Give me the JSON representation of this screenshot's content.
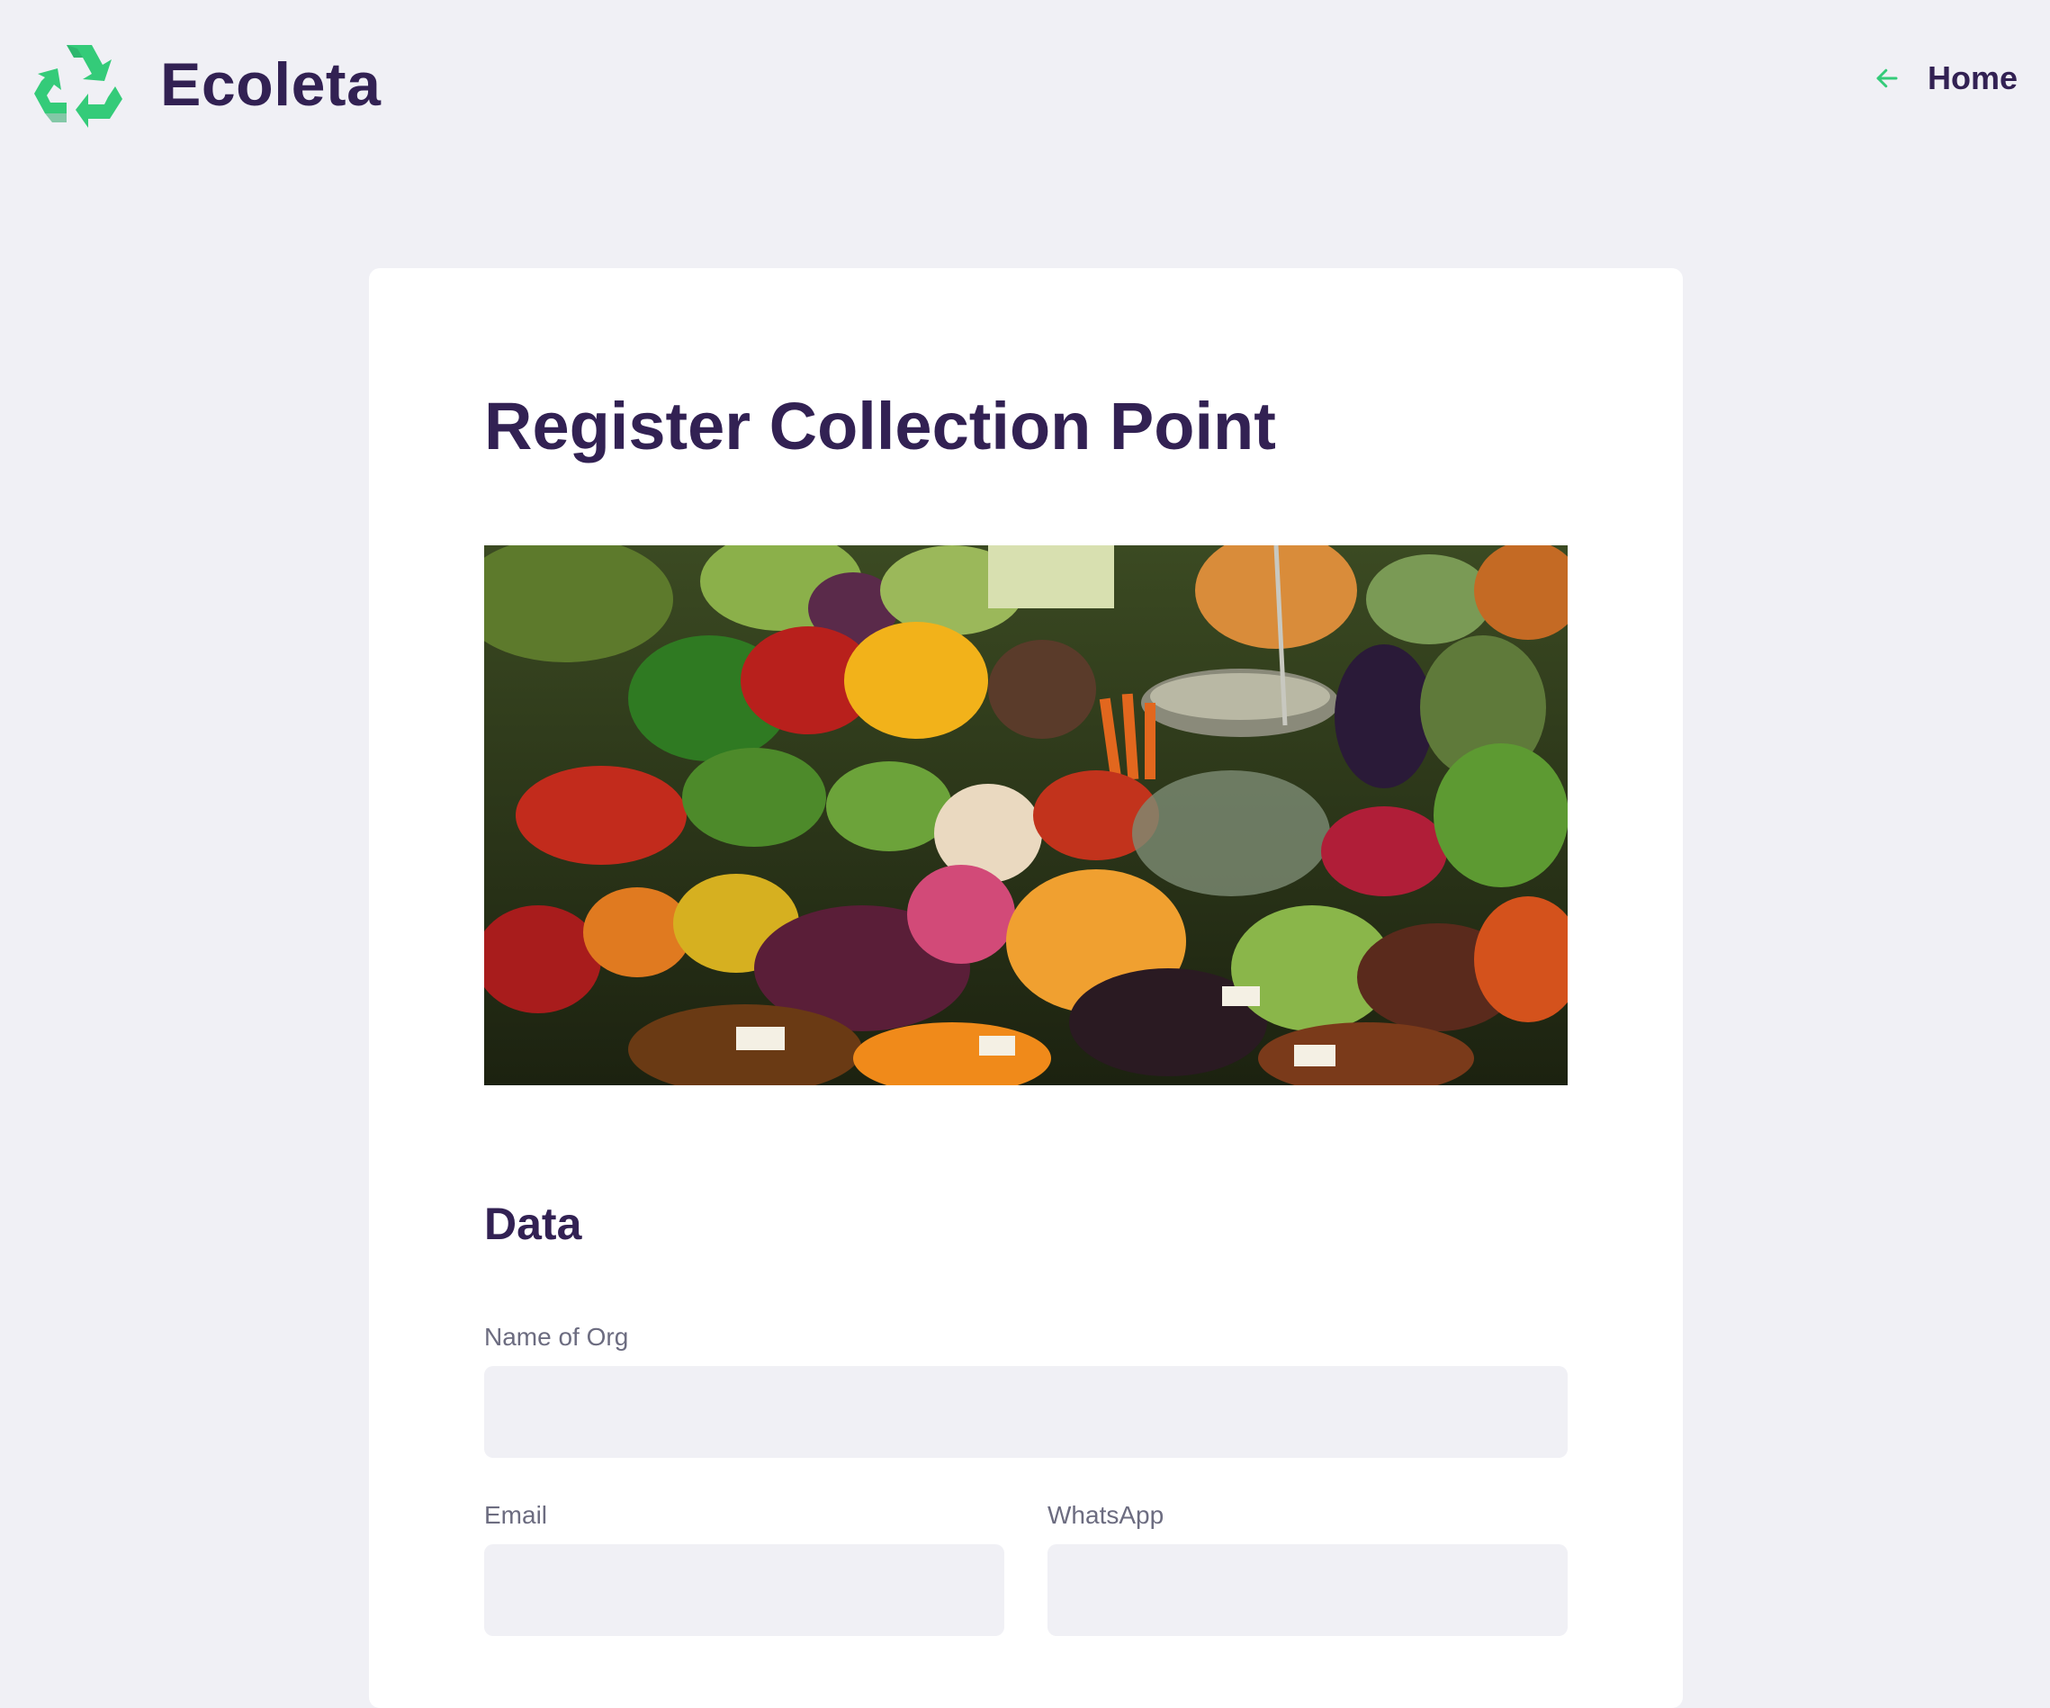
{
  "header": {
    "brand": "Ecoleta",
    "logo_icon": "recycle-icon",
    "home_link": {
      "label": "Home",
      "icon": "arrow-left-icon"
    },
    "accent_color": "#34cb79"
  },
  "form": {
    "title": "Register Collection Point",
    "hero_image": "produce-market-photo",
    "section_title": "Data",
    "fields": {
      "name": {
        "label": "Name of Org",
        "value": ""
      },
      "email": {
        "label": "Email",
        "value": ""
      },
      "whatsapp": {
        "label": "WhatsApp",
        "value": ""
      }
    }
  },
  "colors": {
    "background": "#f0f0f5",
    "title": "#322153",
    "label": "#6c6c80",
    "card": "#ffffff"
  }
}
